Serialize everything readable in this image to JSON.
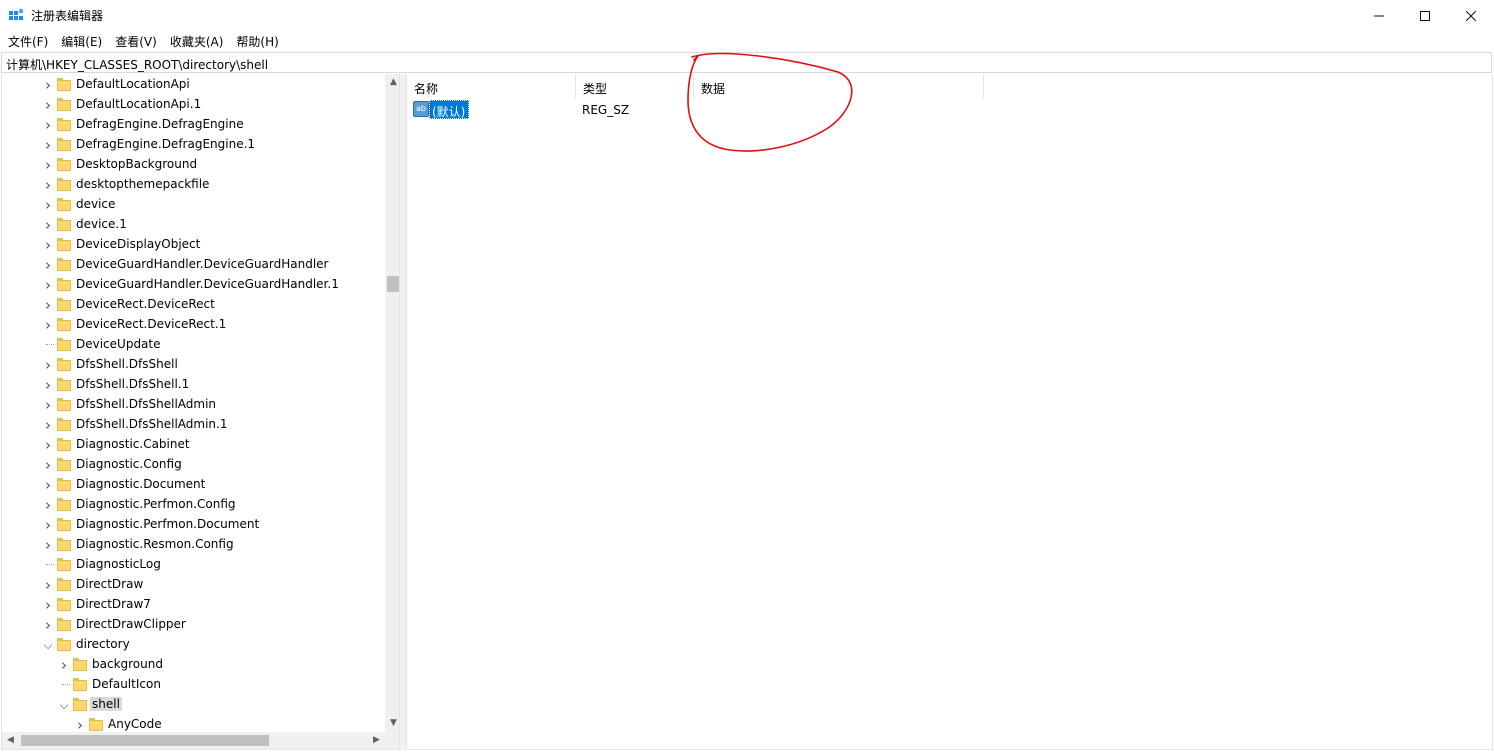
{
  "window": {
    "title": "注册表编辑器",
    "icons": {
      "app": "registry-editor-icon",
      "minimize": "minimize-icon",
      "maximize": "maximize-icon",
      "close": "close-icon"
    }
  },
  "menu": [
    "文件(F)",
    "编辑(E)",
    "查看(V)",
    "收藏夹(A)",
    "帮助(H)"
  ],
  "address": {
    "path": "计算机\\HKEY_CLASSES_ROOT\\directory\\shell"
  },
  "tree": {
    "items": [
      {
        "label": "DefaultLocationApi",
        "level": 0,
        "state": "collapsed"
      },
      {
        "label": "DefaultLocationApi.1",
        "level": 0,
        "state": "collapsed"
      },
      {
        "label": "DefragEngine.DefragEngine",
        "level": 0,
        "state": "collapsed"
      },
      {
        "label": "DefragEngine.DefragEngine.1",
        "level": 0,
        "state": "collapsed"
      },
      {
        "label": "DesktopBackground",
        "level": 0,
        "state": "collapsed"
      },
      {
        "label": "desktopthemepackfile",
        "level": 0,
        "state": "collapsed"
      },
      {
        "label": "device",
        "level": 0,
        "state": "collapsed"
      },
      {
        "label": "device.1",
        "level": 0,
        "state": "collapsed"
      },
      {
        "label": "DeviceDisplayObject",
        "level": 0,
        "state": "collapsed"
      },
      {
        "label": "DeviceGuardHandler.DeviceGuardHandler",
        "level": 0,
        "state": "collapsed"
      },
      {
        "label": "DeviceGuardHandler.DeviceGuardHandler.1",
        "level": 0,
        "state": "collapsed"
      },
      {
        "label": "DeviceRect.DeviceRect",
        "level": 0,
        "state": "collapsed"
      },
      {
        "label": "DeviceRect.DeviceRect.1",
        "level": 0,
        "state": "collapsed"
      },
      {
        "label": "DeviceUpdate",
        "level": 0,
        "state": "leaf"
      },
      {
        "label": "DfsShell.DfsShell",
        "level": 0,
        "state": "collapsed"
      },
      {
        "label": "DfsShell.DfsShell.1",
        "level": 0,
        "state": "collapsed"
      },
      {
        "label": "DfsShell.DfsShellAdmin",
        "level": 0,
        "state": "collapsed"
      },
      {
        "label": "DfsShell.DfsShellAdmin.1",
        "level": 0,
        "state": "collapsed"
      },
      {
        "label": "Diagnostic.Cabinet",
        "level": 0,
        "state": "collapsed"
      },
      {
        "label": "Diagnostic.Config",
        "level": 0,
        "state": "collapsed"
      },
      {
        "label": "Diagnostic.Document",
        "level": 0,
        "state": "collapsed"
      },
      {
        "label": "Diagnostic.Perfmon.Config",
        "level": 0,
        "state": "collapsed"
      },
      {
        "label": "Diagnostic.Perfmon.Document",
        "level": 0,
        "state": "collapsed"
      },
      {
        "label": "Diagnostic.Resmon.Config",
        "level": 0,
        "state": "collapsed"
      },
      {
        "label": "DiagnosticLog",
        "level": 0,
        "state": "leaf"
      },
      {
        "label": "DirectDraw",
        "level": 0,
        "state": "collapsed"
      },
      {
        "label": "DirectDraw7",
        "level": 0,
        "state": "collapsed"
      },
      {
        "label": "DirectDrawClipper",
        "level": 0,
        "state": "collapsed"
      },
      {
        "label": "directory",
        "level": 0,
        "state": "expanded"
      },
      {
        "label": "background",
        "level": 1,
        "state": "collapsed"
      },
      {
        "label": "DefaultIcon",
        "level": 1,
        "state": "leaf"
      },
      {
        "label": "shell",
        "level": 1,
        "state": "expanded",
        "selected": true
      },
      {
        "label": "AnyCode",
        "level": 2,
        "state": "collapsed"
      }
    ]
  },
  "values_pane": {
    "columns": [
      "名称",
      "类型",
      "数据"
    ],
    "rows": [
      {
        "name": "(默认)",
        "type": "REG_SZ",
        "data": "",
        "icon": "string-value-icon"
      }
    ]
  },
  "annotation": {
    "shape": "hand-drawn circle",
    "color": "#e01010",
    "target": "数据 column"
  }
}
